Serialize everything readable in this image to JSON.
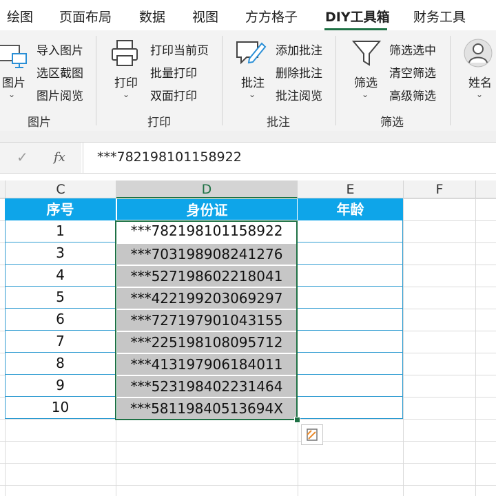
{
  "ribbon_tabs": [
    {
      "label": "绘图",
      "active": false
    },
    {
      "label": "页面布局",
      "active": false
    },
    {
      "label": "数据",
      "active": false
    },
    {
      "label": "视图",
      "active": false
    },
    {
      "label": "方方格子",
      "active": false
    },
    {
      "label": "DIY工具箱",
      "active": true
    },
    {
      "label": "财务工具",
      "active": false
    }
  ],
  "groups": {
    "picture": {
      "title": "图片",
      "big_button": {
        "label": "图片",
        "icon": "picture-monitor-icon"
      },
      "items": [
        "导入图片",
        "选区截图",
        "图片阅览"
      ]
    },
    "print": {
      "title": "打印",
      "big_button": {
        "label": "打印",
        "icon": "printer-icon"
      },
      "items": [
        "打印当前页",
        "批量打印",
        "双面打印"
      ]
    },
    "comment": {
      "title": "批注",
      "big_button": {
        "label": "批注",
        "icon": "comment-pen-icon"
      },
      "items": [
        "添加批注",
        "删除批注",
        "批注阅览"
      ]
    },
    "filter": {
      "title": "筛选",
      "big_button": {
        "label": "筛选",
        "icon": "funnel-icon"
      },
      "items": [
        "筛选选中",
        "清空筛选",
        "高级筛选"
      ]
    },
    "name": {
      "big_button": {
        "label": "姓名",
        "icon": "person-icon"
      }
    }
  },
  "formula_bar": {
    "fx_label": "fx",
    "value": "***782198101158922"
  },
  "columns": [
    "C",
    "D",
    "E",
    "F"
  ],
  "selected_column": "D",
  "table": {
    "headers": [
      "序号",
      "身份证",
      "年龄"
    ],
    "rows": [
      {
        "no": "1",
        "id": "***782198101158922"
      },
      {
        "no": "3",
        "id": "***703198908241276"
      },
      {
        "no": "4",
        "id": "***527198602218041"
      },
      {
        "no": "5",
        "id": "***422199203069297"
      },
      {
        "no": "6",
        "id": "***727197901043155"
      },
      {
        "no": "7",
        "id": "***225198108095712"
      },
      {
        "no": "8",
        "id": "***413197906184011"
      },
      {
        "no": "9",
        "id": "***523198402231464"
      },
      {
        "no": "10",
        "id": "***58119840513694X"
      }
    ]
  },
  "colors": {
    "accent": "#1e7145",
    "header_fill": "#0ea5e9",
    "selection_fill": "#c6c6c6"
  }
}
